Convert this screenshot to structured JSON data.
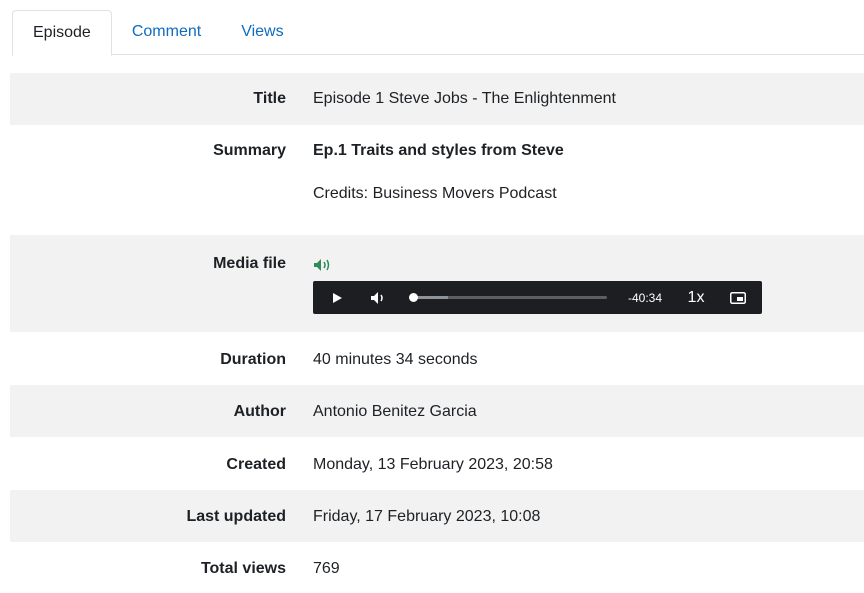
{
  "tabs": [
    {
      "label": "Episode",
      "active": true
    },
    {
      "label": "Comment",
      "active": false
    },
    {
      "label": "Views",
      "active": false
    }
  ],
  "details": {
    "title": {
      "label": "Title",
      "value": "Episode 1 Steve Jobs - The Enlightenment"
    },
    "summary": {
      "label": "Summary",
      "headline": "Ep.1 Traits and styles from Steve",
      "credits": "Credits: Business Movers Podcast"
    },
    "media": {
      "label": "Media file",
      "icon": "audio-file-icon"
    },
    "duration": {
      "label": "Duration",
      "value": "40 minutes 34 seconds"
    },
    "author": {
      "label": "Author",
      "value": "Antonio Benitez Garcia"
    },
    "created": {
      "label": "Created",
      "value": "Monday, 13 February 2023, 20:58"
    },
    "last_updated": {
      "label": "Last updated",
      "value": "Friday, 17 February 2023, 10:08"
    },
    "total_views": {
      "label": "Total views",
      "value": "769"
    }
  },
  "player": {
    "time_remaining": "-40:34",
    "playback_rate": "1x",
    "progress": 0.0,
    "buffered": 0.18
  },
  "colors": {
    "accent": "#0f6cbf",
    "row_shade": "#f2f2f2",
    "player_bg": "#1c1e21"
  }
}
